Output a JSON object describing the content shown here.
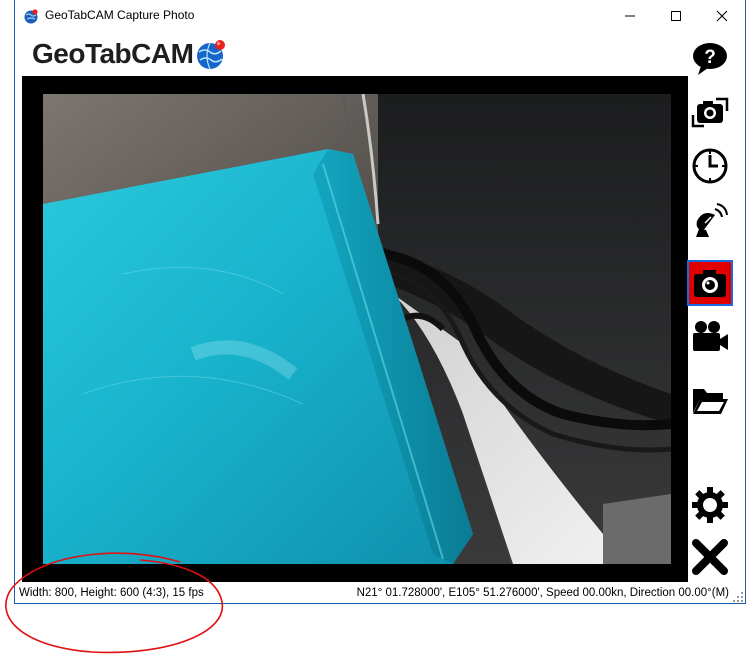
{
  "window": {
    "title": "GeoTabCAM Capture Photo",
    "controls": {
      "minimize": "minimize",
      "maximize": "maximize",
      "close": "close"
    }
  },
  "logo": {
    "text": "GeoTabCAM"
  },
  "toolbar": {
    "buttons": [
      {
        "id": "help",
        "icon": "help-icon"
      },
      {
        "id": "switch-camera",
        "icon": "camera-switch-icon"
      },
      {
        "id": "timer",
        "icon": "clock-icon"
      },
      {
        "id": "gps",
        "icon": "satellite-dish-icon"
      },
      {
        "id": "photo",
        "icon": "camera-icon",
        "active": true
      },
      {
        "id": "video",
        "icon": "video-camera-icon"
      },
      {
        "id": "folder",
        "icon": "folder-icon"
      },
      {
        "id": "settings",
        "icon": "gear-icon"
      },
      {
        "id": "exit",
        "icon": "close-x-icon"
      }
    ]
  },
  "status": {
    "resolution": "Width: 800, Height: 600 (4:3), 15 fps",
    "gps": "N21° 01.728000', E105° 51.276000', Speed 00.00kn, Direction 00.00°(M)"
  },
  "colors": {
    "active_button": "#e00000",
    "annotation_circle": "#e01010",
    "window_border": "#1f5fb0"
  }
}
